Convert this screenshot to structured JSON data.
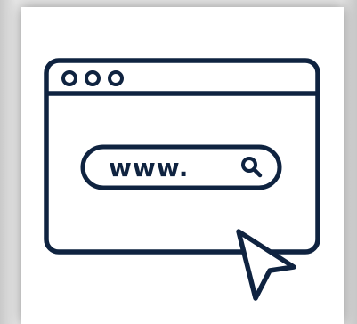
{
  "illustration": {
    "address_text": "www.",
    "window_dots": 3,
    "icons": [
      "browser-window-icon",
      "search-icon",
      "mouse-pointer-icon"
    ],
    "colors": {
      "stroke": "#0f2340",
      "card": "#ffffff",
      "background": "#dcdcdc"
    }
  }
}
